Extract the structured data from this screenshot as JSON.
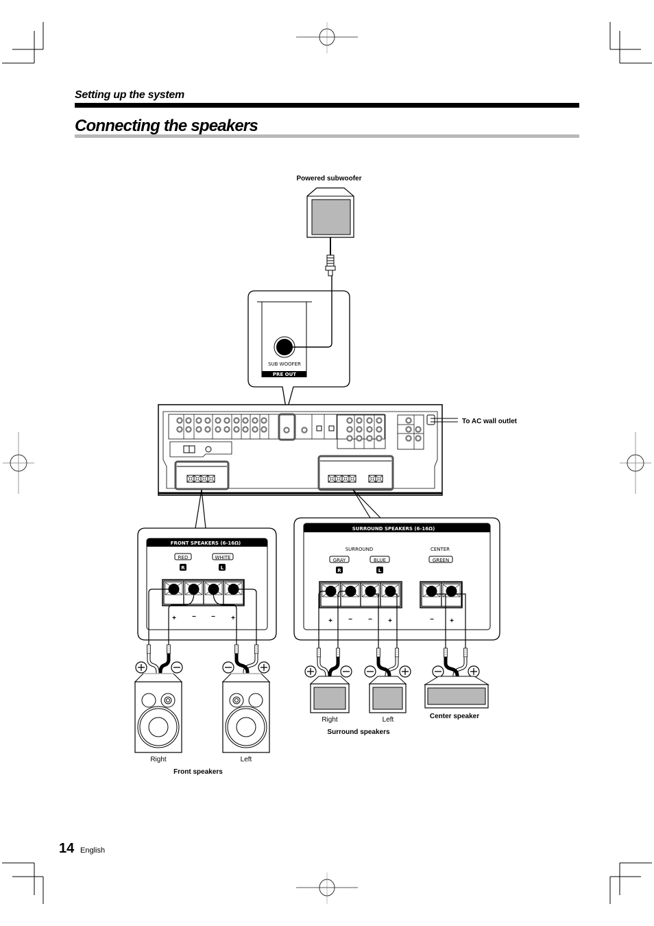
{
  "header": {
    "section_title": "Setting up the system",
    "page_title": "Connecting the speakers"
  },
  "diagram": {
    "subwoofer_label": "Powered subwoofer",
    "sub_woofer_jack_label": "SUB WOOFER",
    "pre_out_label": "PRE OUT",
    "ac_outlet_label": "To AC wall outlet",
    "front_panel": {
      "title": "FRONT SPEAKERS (6-16Ω)",
      "color_tags": [
        "RED",
        "WHITE"
      ],
      "channel_badges": [
        "R",
        "L"
      ],
      "polarity": [
        "+",
        "−",
        "−",
        "+"
      ]
    },
    "surround_panel": {
      "title": "SURROUND SPEAKERS (6-16Ω)",
      "group_labels": [
        "SURROUND",
        "CENTER"
      ],
      "color_tags": [
        "GRAY",
        "BLUE",
        "GREEN"
      ],
      "channel_badges": [
        "R",
        "L"
      ],
      "polarity": [
        "+",
        "−",
        "−",
        "+",
        "−",
        "+"
      ]
    },
    "speakers": {
      "front_right": "Right",
      "front_left": "Left",
      "front_group": "Front speakers",
      "surround_right": "Right",
      "surround_left": "Left",
      "surround_group": "Surround speakers",
      "center": "Center speaker"
    },
    "terminal_symbols": {
      "plus": "+",
      "minus": "−"
    }
  },
  "footer": {
    "page_number": "14",
    "language": "English"
  }
}
